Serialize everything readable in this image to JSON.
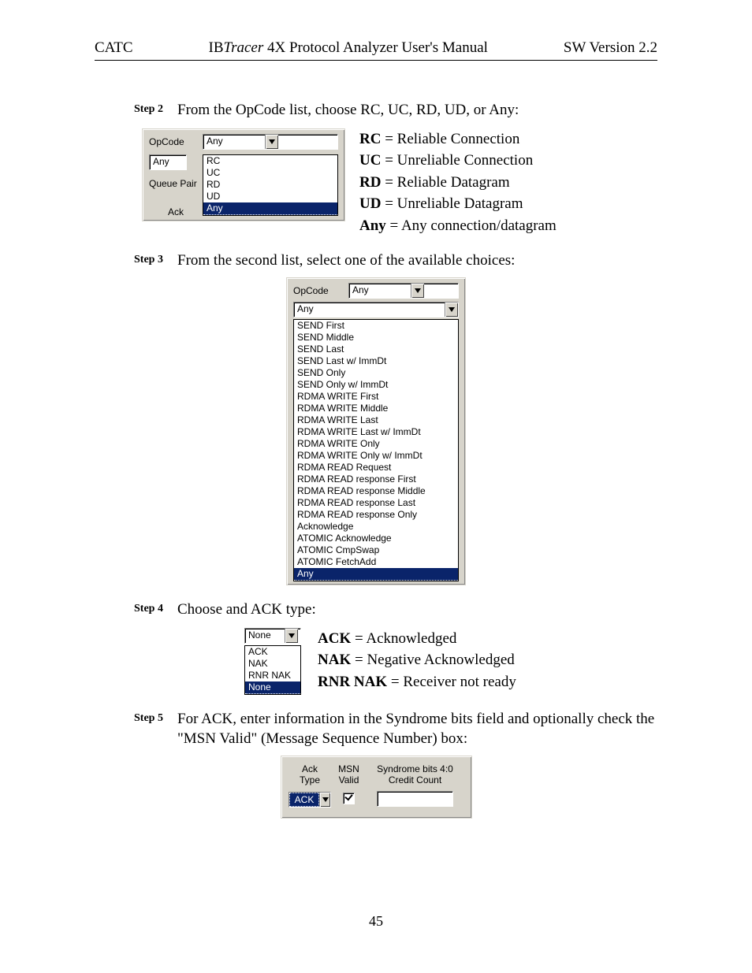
{
  "header": {
    "left": "CATC",
    "mid_prefix": "IB",
    "mid_italic": "Tracer",
    "mid_suffix": " 4X Protocol Analyzer User's Manual",
    "right": "SW Version 2.2"
  },
  "page_number": "45",
  "steps": {
    "s2": {
      "label": "Step 2",
      "text": "From the OpCode list, choose RC, UC, RD, UD, or Any:"
    },
    "s3": {
      "label": "Step 3",
      "text": "From the second list, select one of the available choices:"
    },
    "s4": {
      "label": "Step 4",
      "text": "Choose and ACK type:"
    },
    "s5": {
      "label": "Step 5",
      "text": "For ACK, enter information in the Syndrome bits field and optionally check the \"MSN Valid\" (Message Sequence Number) box:"
    }
  },
  "fig2": {
    "opcodeLabel": "OpCode",
    "opcodeValue": "Any",
    "queueLabel": "Queue Pair",
    "ackLabel": "Ack",
    "secondListValue": "Any",
    "listItems": [
      "RC",
      "UC",
      "RD",
      "UD",
      "Any"
    ],
    "defs": {
      "rc_k": "RC",
      "rc_v": " = Reliable Connection",
      "uc_k": "UC",
      "uc_v": " = Unreliable Connection",
      "rd_k": "RD",
      "rd_v": " = Reliable Datagram",
      "ud_k": "UD",
      "ud_v": " = Unreliable Datagram",
      "any_k": "Any",
      "any_v": " = Any connection/datagram"
    }
  },
  "fig3": {
    "opcodeLabel": "OpCode",
    "opcodeValue": "Any",
    "secondValue": "Any",
    "listItems": [
      "SEND First",
      "SEND Middle",
      "SEND Last",
      "SEND Last w/ ImmDt",
      "SEND Only",
      "SEND Only w/ ImmDt",
      "RDMA WRITE First",
      "RDMA WRITE Middle",
      "RDMA WRITE Last",
      "RDMA WRITE Last w/ ImmDt",
      "RDMA WRITE Only",
      "RDMA WRITE Only w/ ImmDt",
      "RDMA READ Request",
      "RDMA READ response First",
      "RDMA READ response Middle",
      "RDMA READ response Last",
      "RDMA READ response Only",
      "Acknowledge",
      "ATOMIC Acknowledge",
      "ATOMIC CmpSwap",
      "ATOMIC FetchAdd",
      "Any"
    ]
  },
  "fig4": {
    "value": "None",
    "listItems": [
      "ACK",
      "NAK",
      "RNR NAK",
      "None"
    ],
    "defs": {
      "ack_k": "ACK",
      "ack_v": " = Acknowledged",
      "nak_k": "NAK",
      "nak_v": " = Negative Acknowledged",
      "rnr_k": "RNR NAK",
      "rnr_v": " = Receiver not ready"
    }
  },
  "fig5": {
    "col1a": "Ack",
    "col1b": "Type",
    "col2a": "MSN",
    "col2b": "Valid",
    "col3a": "Syndrome bits 4:0",
    "col3b": "Credit Count",
    "ackValue": "ACK"
  }
}
